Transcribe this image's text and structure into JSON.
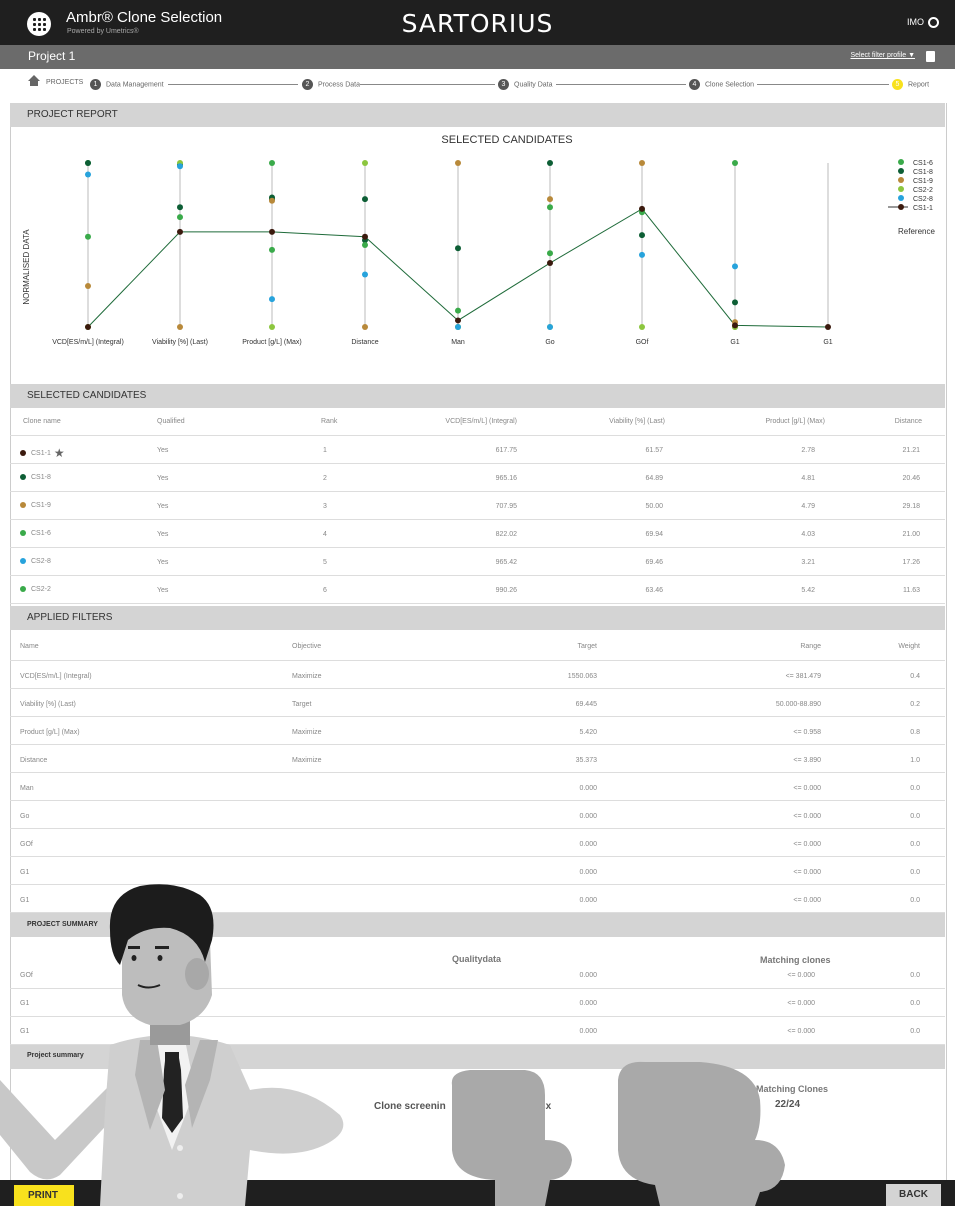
{
  "header": {
    "app_title": "Ambr® Clone Selection",
    "app_subtitle": "Powered by Umetrics®",
    "brand": "SARTORIUS",
    "user": "IMO",
    "project_title": "Project 1",
    "filter_profile": "Select filter profile ▼"
  },
  "steps": [
    "PROJECTS",
    "Data Management",
    "Process Data",
    "Quality Data",
    "Clone Selection",
    "Report"
  ],
  "sections": {
    "project_report": "PROJECT REPORT",
    "selected_candidates": "SELECTED CANDIDATES",
    "applied_filters": "APPLIED FILTERS",
    "project_summary": "PROJECT SUMMARY",
    "project_summary_2": "Project summary"
  },
  "chart_data": {
    "type": "line",
    "title": "SELECTED CANDIDATES",
    "ylabel": "NORMALISED DATA",
    "categories": [
      "VCD[ES/m/L] (Integral)",
      "Viability [%] (Last)",
      "Product [g/L] (Max)",
      "Distance",
      "Man",
      "Go",
      "GOf",
      "G1",
      "G1"
    ],
    "ylim": [
      0,
      1
    ],
    "legend_title": "Reference",
    "series": [
      {
        "name": "CS1-6",
        "color": "#3aaa4a",
        "values": [
          0.55,
          0.67,
          0.47,
          0.5,
          0.1,
          0.45,
          0.7,
          1.0,
          null
        ]
      },
      {
        "name": "CS1-8",
        "color": "#0d5e35",
        "values": [
          1.0,
          0.73,
          0.78,
          0.78,
          0.48,
          1.0,
          0.56,
          0.15,
          null
        ]
      },
      {
        "name": "CS1-9",
        "color": "#b8893a",
        "values": [
          0.25,
          0.0,
          0.77,
          0.0,
          1.0,
          0.78,
          1.0,
          0.03,
          null
        ]
      },
      {
        "name": "CS2-2",
        "color": "#8cc63f",
        "values": [
          0.0,
          1.0,
          0.0,
          1.0,
          0.0,
          0.0,
          0.0,
          0.0,
          null
        ]
      },
      {
        "name": "CS2-8",
        "color": "#27a3dc",
        "values": [
          0.93,
          0.98,
          0.17,
          0.32,
          0.0,
          0.0,
          0.44,
          0.37,
          null
        ]
      },
      {
        "name": "CS1-1",
        "color": "#3b1a0e",
        "reference": true,
        "values": [
          0.0,
          0.58,
          0.58,
          0.55,
          0.04,
          0.39,
          0.72,
          0.01,
          0.0
        ]
      }
    ],
    "extra_points": [
      {
        "series": "CS1-6",
        "category": 0,
        "value": 1.0
      },
      {
        "series": "CS1-8",
        "category": 1,
        "value": 0.99
      },
      {
        "series": "CS1-6",
        "category": 2,
        "value": 1.0
      },
      {
        "series": "CS1-8",
        "category": 2,
        "value": 0.79
      },
      {
        "series": "CS1-8",
        "category": 3,
        "value": 0.53
      },
      {
        "series": "CS1-6",
        "category": 4,
        "value": 0.0
      },
      {
        "series": "CS1-6",
        "category": 5,
        "value": 0.73
      },
      {
        "series": "CS1-6",
        "category": 6,
        "value": 0.71
      },
      {
        "series": "CS1-6",
        "category": 7,
        "value": 0.0
      }
    ]
  },
  "candidates": {
    "headers": [
      "Clone name",
      "Qualified",
      "Rank",
      "VCD[ES/m/L] (Integral)",
      "Viability [%] (Last)",
      "Product [g/L] (Max)",
      "Distance"
    ],
    "rows": [
      {
        "name": "CS1-1",
        "color": "#3b1a0e",
        "star": true,
        "qualified": "Yes",
        "rank": "1",
        "vcd": "617.75",
        "viability": "61.57",
        "product": "2.78",
        "distance": "21.21"
      },
      {
        "name": "CS1-8",
        "color": "#0d5e35",
        "star": false,
        "qualified": "Yes",
        "rank": "2",
        "vcd": "965.16",
        "viability": "64.89",
        "product": "4.81",
        "distance": "20.46"
      },
      {
        "name": "CS1-9",
        "color": "#b8893a",
        "star": false,
        "qualified": "Yes",
        "rank": "3",
        "vcd": "707.95",
        "viability": "50.00",
        "product": "4.79",
        "distance": "29.18"
      },
      {
        "name": "CS1-6",
        "color": "#3aaa4a",
        "star": false,
        "qualified": "Yes",
        "rank": "4",
        "vcd": "822.02",
        "viability": "69.94",
        "product": "4.03",
        "distance": "21.00"
      },
      {
        "name": "CS2-8",
        "color": "#27a3dc",
        "star": false,
        "qualified": "Yes",
        "rank": "5",
        "vcd": "965.42",
        "viability": "69.46",
        "product": "3.21",
        "distance": "17.26"
      },
      {
        "name": "CS2-2",
        "color": "#3aaa4a",
        "star": false,
        "qualified": "Yes",
        "rank": "6",
        "vcd": "990.26",
        "viability": "63.46",
        "product": "5.42",
        "distance": "11.63"
      }
    ]
  },
  "filters": {
    "headers": [
      "Name",
      "Objective",
      "Target",
      "Range",
      "Weight"
    ],
    "rows": [
      {
        "name": "VCD[ES/m/L] (Integral)",
        "objective": "Maximize",
        "target": "1550.063",
        "range": "<= 381.479",
        "weight": "0.4"
      },
      {
        "name": "Viability [%] (Last)",
        "objective": "Target",
        "target": "69.445",
        "range": "50.000-88.890",
        "weight": "0.2"
      },
      {
        "name": "Product [g/L] (Max)",
        "objective": "Maximize",
        "target": "5.420",
        "range": "<= 0.958",
        "weight": "0.8"
      },
      {
        "name": "Distance",
        "objective": "Maximize",
        "target": "35.373",
        "range": "<= 3.890",
        "weight": "1.0"
      },
      {
        "name": "Man",
        "objective": "",
        "target": "0.000",
        "range": "<= 0.000",
        "weight": "0.0"
      },
      {
        "name": "Go",
        "objective": "",
        "target": "0.000",
        "range": "<= 0.000",
        "weight": "0.0"
      },
      {
        "name": "GOf",
        "objective": "",
        "target": "0.000",
        "range": "<= 0.000",
        "weight": "0.0"
      },
      {
        "name": "G1",
        "objective": "",
        "target": "0.000",
        "range": "<= 0.000",
        "weight": "0.0"
      },
      {
        "name": "G1",
        "objective": "",
        "target": "0.000",
        "range": "<= 0.000",
        "weight": "0.0"
      }
    ]
  },
  "summary": {
    "qualitydata_label": "Qualitydata",
    "matching_clones_label": "Matching clones",
    "rows": [
      {
        "name": "GOf",
        "target": "0.000",
        "range": "<= 0.000",
        "weight": "0.0"
      },
      {
        "name": "G1",
        "target": "0.000",
        "range": "<= 0.000",
        "weight": "0.0"
      },
      {
        "name": "G1",
        "target": "0.000",
        "range": "<= 0.000",
        "weight": "0.0"
      }
    ],
    "file_label_left": "Clone screenin",
    "file_label_right": "at.xlsx",
    "matching_clones_label_2": "Matching Clones",
    "matching_clones_value": "22/24"
  },
  "buttons": {
    "print": "PRINT",
    "back": "BACK"
  }
}
